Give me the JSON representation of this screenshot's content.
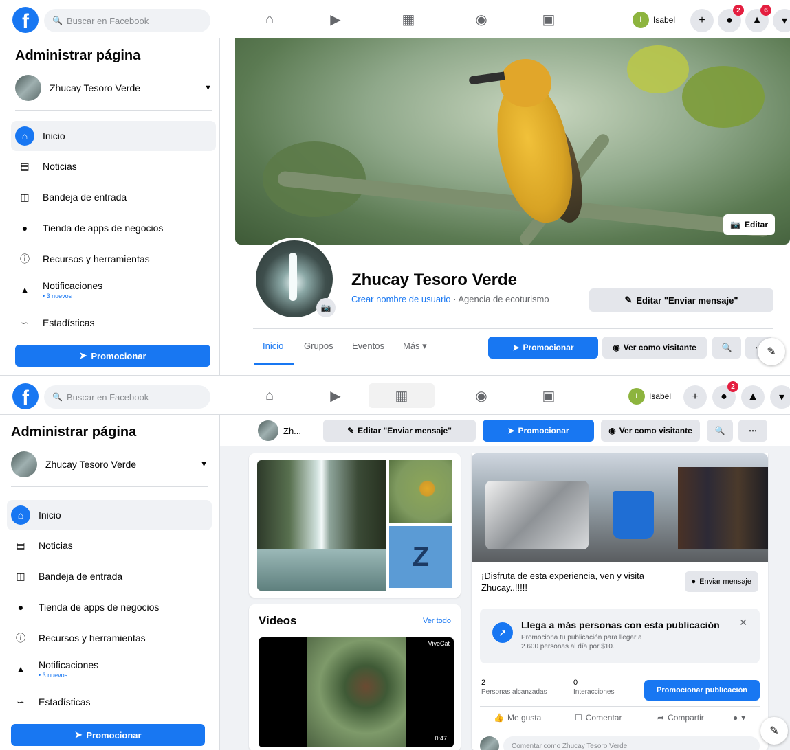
{
  "topbar": {
    "logo": "f",
    "search_placeholder": "Buscar en Facebook",
    "user_name": "Isabel",
    "user_initial": "I",
    "messenger_badge": "2",
    "notif_badge": "6"
  },
  "sidebar": {
    "title": "Administrar página",
    "page_name": "Zhucay Tesoro Verde",
    "items": [
      {
        "label": "Inicio",
        "icon": "home-icon"
      },
      {
        "label": "Noticias",
        "icon": "news-icon"
      },
      {
        "label": "Bandeja de entrada",
        "icon": "inbox-icon"
      },
      {
        "label": "Tienda de apps de negocios",
        "icon": "store-icon"
      },
      {
        "label": "Recursos y herramientas",
        "icon": "info-icon"
      },
      {
        "label": "Notificaciones",
        "icon": "bell-icon",
        "sub": "• 3 nuevos"
      },
      {
        "label": "Estadísticas",
        "icon": "stats-icon"
      }
    ],
    "promote_label": "Promocionar"
  },
  "profile": {
    "edit_cover": "Editar",
    "name": "Zhucay Tesoro Verde",
    "username_link": "Crear nombre de usuario",
    "separator": " · ",
    "category": "Agencia de ecoturismo",
    "edit_send_message": "Editar \"Enviar mensaje\"",
    "tabs": [
      "Inicio",
      "Grupos",
      "Eventos",
      "Más ▾"
    ],
    "promote": "Promocionar",
    "view_as_visitor": "Ver como visitante"
  },
  "sticky": {
    "short_name": "Zh..."
  },
  "photos": {
    "tile_letter": "Z"
  },
  "videos": {
    "title": "Videos",
    "see_all": "Ver todo",
    "channel": "ViveCat",
    "duration": "0:47"
  },
  "post": {
    "text": "¡Disfruta de esta experiencia, ven y visita Zhucay..!!!!!",
    "send_message": "Enviar mensaje",
    "reach_title": "Llega a más personas con esta publicación",
    "reach_sub": "Promociona tu publicación para llegar a 2.600 personas al día por $10.",
    "people_reached": "2",
    "people_reached_label": "Personas alcanzadas",
    "interactions": "0",
    "interactions_label": "Interacciones",
    "promote_post": "Promocionar publicación",
    "like": "Me gusta",
    "comment": "Comentar",
    "share": "Compartir",
    "comment_placeholder": "Comentar como Zhucay Tesoro Verde"
  }
}
